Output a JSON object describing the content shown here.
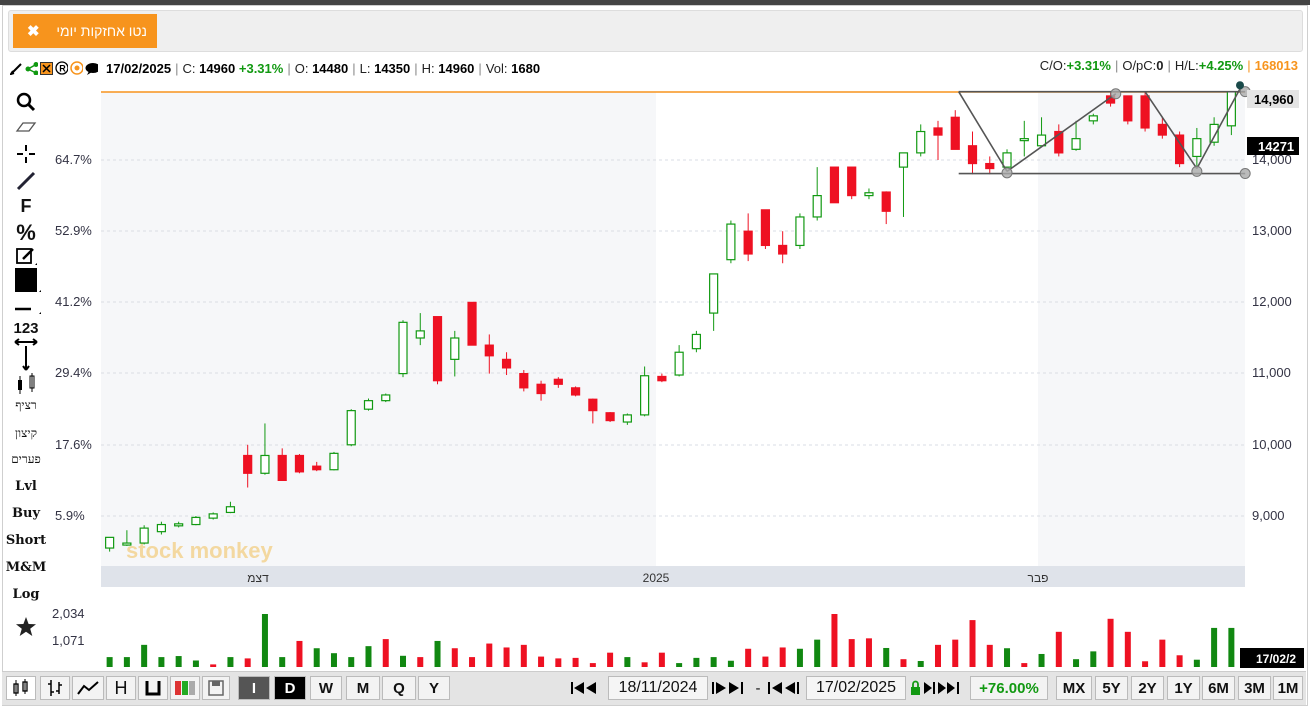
{
  "window": {
    "tab_label": "נטו אחזקות יומי",
    "close_glyph": "✖"
  },
  "info": {
    "date": "17/02/2025",
    "close_label": "C:",
    "close_value": "14960",
    "change": "+3.31%",
    "open_label": "O:",
    "open_value": "14480",
    "low_label": "L:",
    "low_value": "14350",
    "high_label": "H:",
    "high_value": "14960",
    "vol_label": "Vol:",
    "vol_value": "1680",
    "co_label": "C/O:",
    "co_value": "+3.31%",
    "opc_label": "O/pC:",
    "opc_value": "0",
    "hl_label": "H/L:",
    "hl_value": "+4.25%",
    "code": "168013"
  },
  "left_tools": {
    "f_label": "F",
    "pct_label": "%",
    "num_label": "123",
    "continuous": "רציף",
    "cutoff": "קיצון",
    "gaps": "פערים",
    "lvl": "Lvl",
    "buy": "Buy",
    "short": "Short",
    "mm": "M&M",
    "log": "Log"
  },
  "axes": {
    "left_pct": [
      "64.7%",
      "52.9%",
      "41.2%",
      "29.4%",
      "17.6%",
      "5.9%"
    ],
    "right_prices": [
      "14,000",
      "13,000",
      "12,000",
      "11,000",
      "10,000",
      "9,000"
    ],
    "last_price": "14,960",
    "cursor_price": "14271",
    "x_labels": [
      "דצמ",
      "2025",
      "פבר"
    ],
    "volume_ticks": [
      "2,034",
      "1,071"
    ],
    "volume_date_tag": "17/02/2"
  },
  "watermark": "stock monkey",
  "bottom": {
    "periods": [
      "I",
      "D",
      "W",
      "M",
      "Q",
      "Y"
    ],
    "start_date": "18/11/2024",
    "end_date": "17/02/2025",
    "range_change": "+76.00%",
    "ranges": [
      "MX",
      "5Y",
      "2Y",
      "1Y",
      "6M",
      "3M",
      "1M"
    ]
  },
  "colors": {
    "up": "#119911",
    "down": "#ee1122",
    "accent": "#f7941d"
  },
  "chart_data": {
    "type": "candlestick",
    "ylim": [
      8000,
      15200
    ],
    "candles": [
      {
        "o": 8550,
        "h": 8700,
        "l": 8500,
        "c": 8700
      },
      {
        "o": 8600,
        "h": 8800,
        "l": 8580,
        "c": 8620
      },
      {
        "o": 8620,
        "h": 8870,
        "l": 8600,
        "c": 8830
      },
      {
        "o": 8780,
        "h": 8920,
        "l": 8740,
        "c": 8880
      },
      {
        "o": 8870,
        "h": 8920,
        "l": 8840,
        "c": 8890
      },
      {
        "o": 8880,
        "h": 9000,
        "l": 8870,
        "c": 8980
      },
      {
        "o": 8970,
        "h": 9050,
        "l": 8950,
        "c": 9030
      },
      {
        "o": 9050,
        "h": 9200,
        "l": 9040,
        "c": 9130
      },
      {
        "o": 9850,
        "h": 10000,
        "l": 9400,
        "c": 9600
      },
      {
        "o": 9600,
        "h": 10300,
        "l": 9580,
        "c": 9850
      },
      {
        "o": 9850,
        "h": 9950,
        "l": 9500,
        "c": 9500
      },
      {
        "o": 9850,
        "h": 9870,
        "l": 9600,
        "c": 9620
      },
      {
        "o": 9700,
        "h": 9760,
        "l": 9630,
        "c": 9650
      },
      {
        "o": 9650,
        "h": 9900,
        "l": 9640,
        "c": 9880
      },
      {
        "o": 10000,
        "h": 10500,
        "l": 9980,
        "c": 10480
      },
      {
        "o": 10500,
        "h": 10650,
        "l": 10480,
        "c": 10620
      },
      {
        "o": 10620,
        "h": 10720,
        "l": 10600,
        "c": 10700
      },
      {
        "o": 11000,
        "h": 11750,
        "l": 10950,
        "c": 11720
      },
      {
        "o": 11500,
        "h": 11850,
        "l": 11400,
        "c": 11600
      },
      {
        "o": 11800,
        "h": 11800,
        "l": 10850,
        "c": 10900
      },
      {
        "o": 11200,
        "h": 11600,
        "l": 10960,
        "c": 11500
      },
      {
        "o": 12000,
        "h": 12000,
        "l": 11400,
        "c": 11400
      },
      {
        "o": 11400,
        "h": 11550,
        "l": 11000,
        "c": 11250
      },
      {
        "o": 11200,
        "h": 11300,
        "l": 10980,
        "c": 11080
      },
      {
        "o": 11000,
        "h": 11050,
        "l": 10750,
        "c": 10800
      },
      {
        "o": 10850,
        "h": 10900,
        "l": 10620,
        "c": 10720
      },
      {
        "o": 10920,
        "h": 10950,
        "l": 10800,
        "c": 10850
      },
      {
        "o": 10800,
        "h": 10820,
        "l": 10680,
        "c": 10700
      },
      {
        "o": 10640,
        "h": 10650,
        "l": 10300,
        "c": 10480
      },
      {
        "o": 10450,
        "h": 10460,
        "l": 10320,
        "c": 10340
      },
      {
        "o": 10320,
        "h": 10440,
        "l": 10280,
        "c": 10420
      },
      {
        "o": 10420,
        "h": 11100,
        "l": 10400,
        "c": 10970
      },
      {
        "o": 10960,
        "h": 11000,
        "l": 10880,
        "c": 10900
      },
      {
        "o": 10980,
        "h": 11400,
        "l": 10960,
        "c": 11300
      },
      {
        "o": 11350,
        "h": 11600,
        "l": 11300,
        "c": 11550
      },
      {
        "o": 11850,
        "h": 12400,
        "l": 11600,
        "c": 12400
      },
      {
        "o": 12600,
        "h": 13150,
        "l": 12550,
        "c": 13100
      },
      {
        "o": 13000,
        "h": 13250,
        "l": 12580,
        "c": 12680
      },
      {
        "o": 13300,
        "h": 13300,
        "l": 12750,
        "c": 12800
      },
      {
        "o": 12800,
        "h": 13000,
        "l": 12550,
        "c": 12680
      },
      {
        "o": 12800,
        "h": 13250,
        "l": 12750,
        "c": 13200
      },
      {
        "o": 13200,
        "h": 13900,
        "l": 13150,
        "c": 13500
      },
      {
        "o": 13900,
        "h": 13900,
        "l": 13400,
        "c": 13400
      },
      {
        "o": 13900,
        "h": 13900,
        "l": 13450,
        "c": 13500
      },
      {
        "o": 13500,
        "h": 13600,
        "l": 13450,
        "c": 13540
      },
      {
        "o": 13550,
        "h": 13560,
        "l": 13100,
        "c": 13280
      },
      {
        "o": 13900,
        "h": 14000,
        "l": 13200,
        "c": 14100
      },
      {
        "o": 14100,
        "h": 14500,
        "l": 14050,
        "c": 14400
      },
      {
        "o": 14450,
        "h": 14550,
        "l": 14000,
        "c": 14350
      },
      {
        "o": 14600,
        "h": 14700,
        "l": 14150,
        "c": 14150
      },
      {
        "o": 14200,
        "h": 14400,
        "l": 13800,
        "c": 13950
      },
      {
        "o": 13950,
        "h": 14050,
        "l": 13800,
        "c": 13880
      },
      {
        "o": 13900,
        "h": 14150,
        "l": 13880,
        "c": 14100
      },
      {
        "o": 14300,
        "h": 14550,
        "l": 14050,
        "c": 14300
      },
      {
        "o": 14200,
        "h": 14600,
        "l": 14200,
        "c": 14350
      },
      {
        "o": 14400,
        "h": 14500,
        "l": 14050,
        "c": 14100
      },
      {
        "o": 14150,
        "h": 14550,
        "l": 14130,
        "c": 14300
      },
      {
        "o": 14550,
        "h": 14650,
        "l": 14500,
        "c": 14620
      },
      {
        "o": 14900,
        "h": 14950,
        "l": 14750,
        "c": 14800
      },
      {
        "o": 14900,
        "h": 14900,
        "l": 14500,
        "c": 14550
      },
      {
        "o": 14900,
        "h": 14960,
        "l": 14400,
        "c": 14450
      },
      {
        "o": 14500,
        "h": 14600,
        "l": 14300,
        "c": 14350
      },
      {
        "o": 14350,
        "h": 14400,
        "l": 13900,
        "c": 13950
      },
      {
        "o": 14050,
        "h": 14450,
        "l": 13880,
        "c": 14300
      },
      {
        "o": 14250,
        "h": 14600,
        "l": 14200,
        "c": 14500
      },
      {
        "o": 14480,
        "h": 14960,
        "l": 14350,
        "c": 14960
      }
    ],
    "volumes": [
      380,
      380,
      850,
      380,
      420,
      250,
      100,
      380,
      330,
      2034,
      380,
      1000,
      720,
      530,
      380,
      800,
      1071,
      430,
      380,
      1000,
      720,
      380,
      900,
      750,
      850,
      400,
      330,
      350,
      150,
      550,
      380,
      180,
      550,
      150,
      350,
      380,
      240,
      700,
      400,
      750,
      700,
      1050,
      2034,
      1071,
      1100,
      730,
      300,
      230,
      850,
      1050,
      1800,
      850,
      720,
      150,
      500,
      1350,
      300,
      600,
      1850,
      1350,
      220,
      1050,
      450,
      280,
      1500,
      1500
    ],
    "vol_dir": [
      "u",
      "u",
      "u",
      "u",
      "u",
      "u",
      "d",
      "u",
      "d",
      "u",
      "u",
      "d",
      "u",
      "u",
      "u",
      "u",
      "d",
      "u",
      "d",
      "u",
      "d",
      "d",
      "d",
      "d",
      "d",
      "d",
      "d",
      "d",
      "d",
      "d",
      "u",
      "d",
      "d",
      "u",
      "u",
      "u",
      "u",
      "d",
      "d",
      "d",
      "u",
      "u",
      "d",
      "d",
      "d",
      "u",
      "d",
      "u",
      "d",
      "d",
      "d",
      "d",
      "u",
      "d",
      "u",
      "d",
      "u",
      "u",
      "d",
      "d",
      "d",
      "d",
      "d",
      "u",
      "u",
      "u"
    ]
  }
}
